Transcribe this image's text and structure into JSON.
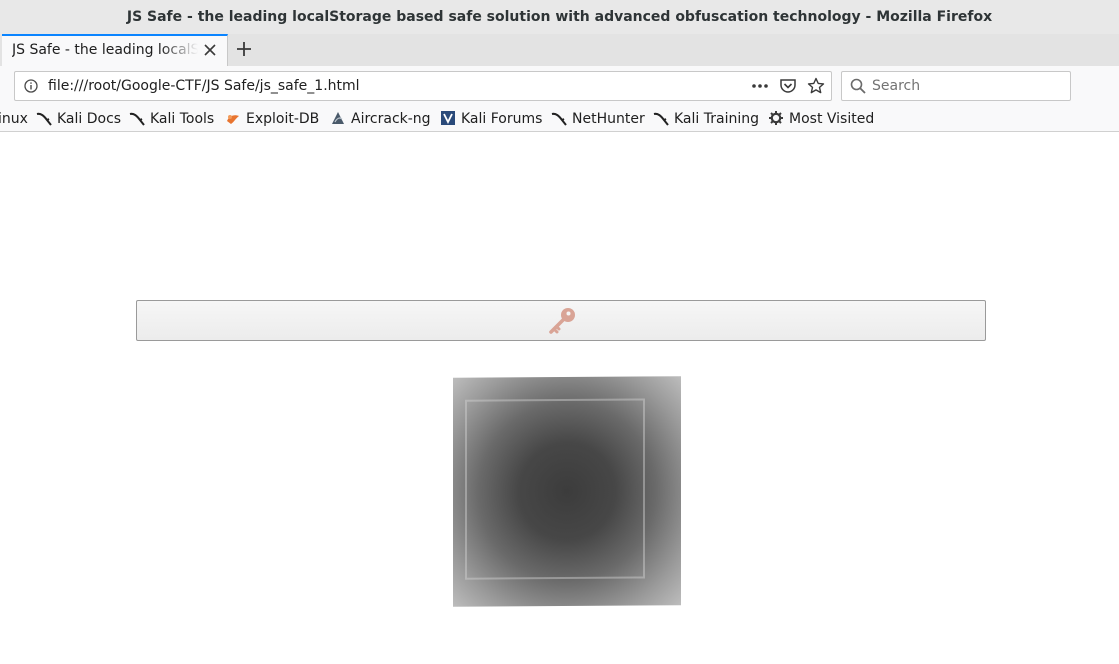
{
  "window": {
    "title": "JS Safe - the leading localStorage based safe solution with advanced obfuscation technology - Mozilla Firefox"
  },
  "tab": {
    "title": "JS Safe - the leading localStorage based safe solution with advanced obfuscation technology"
  },
  "navbar": {
    "url": "file:///root/Google-CTF/JS Safe/js_safe_1.html",
    "search_placeholder": "Search"
  },
  "bookmarks": [
    {
      "label": "inux",
      "icon": "kali-icon"
    },
    {
      "label": "Kali Docs",
      "icon": "kali-dragon-icon"
    },
    {
      "label": "Kali Tools",
      "icon": "kali-dragon-icon"
    },
    {
      "label": "Exploit-DB",
      "icon": "exploit-db-icon"
    },
    {
      "label": "Aircrack-ng",
      "icon": "aircrack-icon"
    },
    {
      "label": "Kali Forums",
      "icon": "kali-forums-icon"
    },
    {
      "label": "NetHunter",
      "icon": "kali-dragon-icon"
    },
    {
      "label": "Kali Training",
      "icon": "kali-dragon-icon"
    },
    {
      "label": "Most Visited",
      "icon": "gear-icon"
    }
  ],
  "page": {
    "key_icon": "key-icon",
    "cube_icon": "safe-cube"
  },
  "colors": {
    "key_icon": "#d9a496",
    "tab_accent": "#0a84ff"
  }
}
